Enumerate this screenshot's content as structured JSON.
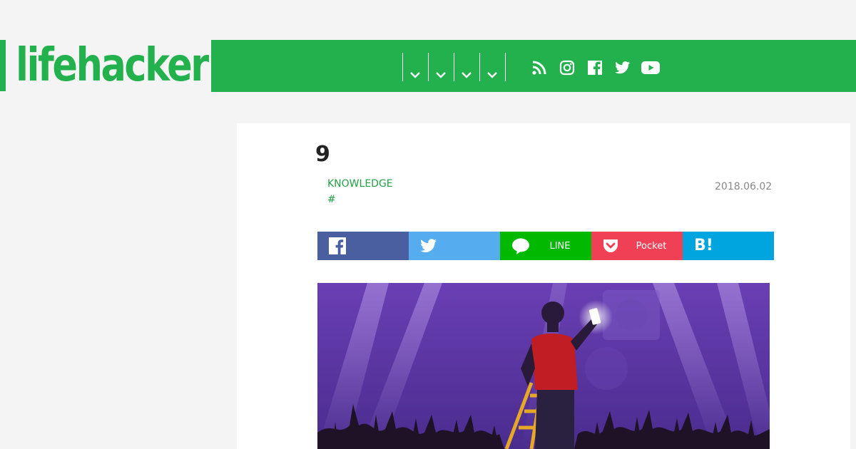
{
  "header": {
    "logo_text": "lifehacker",
    "brand_color": "#22b14c",
    "nav_menus": [
      {
        "icon": "chevron-down-icon"
      },
      {
        "icon": "chevron-down-icon"
      },
      {
        "icon": "chevron-down-icon"
      },
      {
        "icon": "chevron-down-icon"
      }
    ],
    "social": [
      "rss-icon",
      "instagram-icon",
      "facebook-icon",
      "twitter-icon",
      "youtube-icon"
    ]
  },
  "article": {
    "title": "9",
    "category": "KNOWLEDGE",
    "hashtag": "#",
    "date": "2018.06.02"
  },
  "share": {
    "facebook": {
      "label": "",
      "color": "#4a5f9f",
      "icon": "facebook-icon"
    },
    "twitter": {
      "label": "",
      "color": "#55acee",
      "icon": "twitter-icon"
    },
    "line": {
      "label": "LINE",
      "color": "#00b900",
      "icon": "line-icon"
    },
    "pocket": {
      "label": "Pocket",
      "color": "#ef4056",
      "icon": "pocket-icon"
    },
    "hatena": {
      "label": "",
      "color": "#00a4de",
      "icon": "hatena-bookmark-icon"
    }
  },
  "hero_image": {
    "icon": "concert-illustration"
  }
}
